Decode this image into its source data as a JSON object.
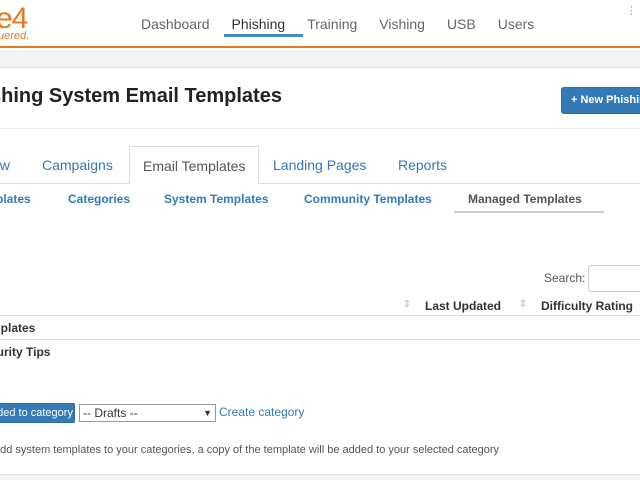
{
  "brand": {
    "logo_text": "e4",
    "tagline": "uered."
  },
  "nav": {
    "items": [
      {
        "label": "Dashboard"
      },
      {
        "label": "Phishing"
      },
      {
        "label": "Training"
      },
      {
        "label": "Vishing"
      },
      {
        "label": "USB"
      },
      {
        "label": "Users"
      }
    ],
    "active": "Phishing"
  },
  "page": {
    "title": "shing System Email Templates",
    "new_button": "+ New Phishin"
  },
  "tabs": [
    "ew",
    "Campaigns",
    "Email Templates",
    "Landing Pages",
    "Reports"
  ],
  "active_tab": "Email Templates",
  "subtabs": [
    "plates",
    "Categories",
    "System Templates",
    "Community Templates",
    "Managed Templates"
  ],
  "active_subtab": "Managed Templates",
  "search": {
    "label": "Search:",
    "value": ""
  },
  "table": {
    "columns": [
      "Last Updated",
      "Difficulty Rating"
    ],
    "rows": [
      "mplates",
      "curity Tips"
    ]
  },
  "actions": {
    "add_button": "dded to category",
    "category_select": "-- Drafts --",
    "create_link": "Create category"
  },
  "help_text": "add system templates to your categories, a copy of the template will be added to your selected category",
  "colors": {
    "brand": "#e87722",
    "link": "#337ab7",
    "button": "#337ab7"
  }
}
